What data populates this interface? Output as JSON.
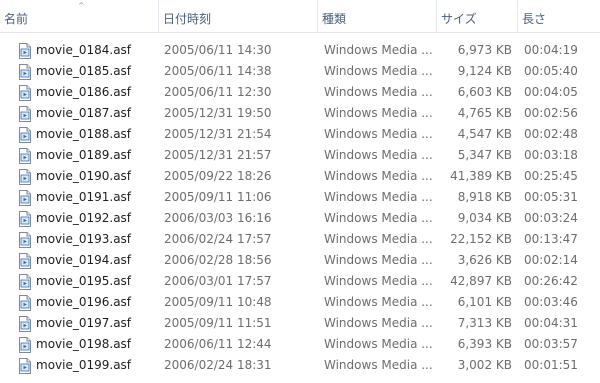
{
  "columns": {
    "name": "名前",
    "date": "日付時刻",
    "type": "種類",
    "size": "サイズ",
    "length": "長さ"
  },
  "sort_indicator": "^",
  "files": [
    {
      "name": "movie_0184.asf",
      "date": "2005/06/11 14:30",
      "type": "Windows Media ...",
      "size": "6,973 KB",
      "length": "00:04:19"
    },
    {
      "name": "movie_0185.asf",
      "date": "2005/06/11 14:38",
      "type": "Windows Media ...",
      "size": "9,124 KB",
      "length": "00:05:40"
    },
    {
      "name": "movie_0186.asf",
      "date": "2005/06/11 12:30",
      "type": "Windows Media ...",
      "size": "6,603 KB",
      "length": "00:04:05"
    },
    {
      "name": "movie_0187.asf",
      "date": "2005/12/31 19:50",
      "type": "Windows Media ...",
      "size": "4,765 KB",
      "length": "00:02:56"
    },
    {
      "name": "movie_0188.asf",
      "date": "2005/12/31 21:54",
      "type": "Windows Media ...",
      "size": "4,547 KB",
      "length": "00:02:48"
    },
    {
      "name": "movie_0189.asf",
      "date": "2005/12/31 21:57",
      "type": "Windows Media ...",
      "size": "5,347 KB",
      "length": "00:03:18"
    },
    {
      "name": "movie_0190.asf",
      "date": "2005/09/22 18:26",
      "type": "Windows Media ...",
      "size": "41,389 KB",
      "length": "00:25:45"
    },
    {
      "name": "movie_0191.asf",
      "date": "2005/09/11 11:06",
      "type": "Windows Media ...",
      "size": "8,918 KB",
      "length": "00:05:31"
    },
    {
      "name": "movie_0192.asf",
      "date": "2006/03/03 16:16",
      "type": "Windows Media ...",
      "size": "9,034 KB",
      "length": "00:03:24"
    },
    {
      "name": "movie_0193.asf",
      "date": "2006/02/24 17:57",
      "type": "Windows Media ...",
      "size": "22,152 KB",
      "length": "00:13:47"
    },
    {
      "name": "movie_0194.asf",
      "date": "2006/02/28 18:56",
      "type": "Windows Media ...",
      "size": "3,626 KB",
      "length": "00:02:14"
    },
    {
      "name": "movie_0195.asf",
      "date": "2006/03/01 17:57",
      "type": "Windows Media ...",
      "size": "42,897 KB",
      "length": "00:26:42"
    },
    {
      "name": "movie_0196.asf",
      "date": "2005/09/11 10:48",
      "type": "Windows Media ...",
      "size": "6,101 KB",
      "length": "00:03:46"
    },
    {
      "name": "movie_0197.asf",
      "date": "2005/09/11 11:51",
      "type": "Windows Media ...",
      "size": "7,313 KB",
      "length": "00:04:31"
    },
    {
      "name": "movie_0198.asf",
      "date": "2006/06/11 12:44",
      "type": "Windows Media ...",
      "size": "6,393 KB",
      "length": "00:03:57"
    },
    {
      "name": "movie_0199.asf",
      "date": "2006/02/24 18:31",
      "type": "Windows Media ...",
      "size": "3,002 KB",
      "length": "00:01:51"
    }
  ],
  "icons": {
    "file": "windows-media-file-icon"
  },
  "colors": {
    "header_text": "#4c607a",
    "name_text": "#1e1e1e",
    "detail_text": "#6d6d6d",
    "icon_accent": "#2f6fba"
  }
}
